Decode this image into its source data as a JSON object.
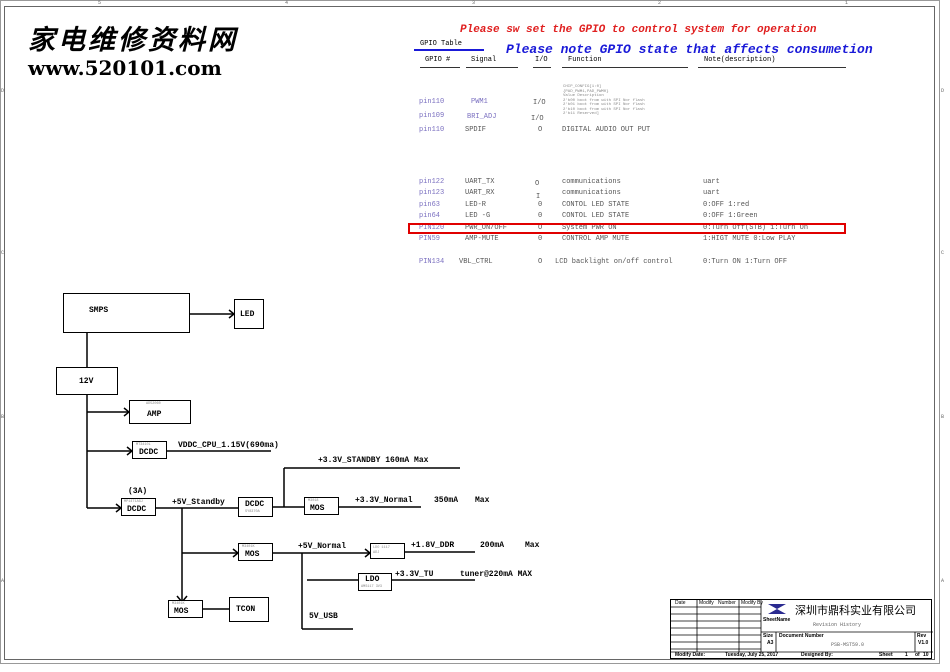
{
  "ruler": {
    "marks": [
      "5",
      "4",
      "3",
      "2",
      "1"
    ],
    "side_marks": [
      "D",
      "C",
      "B",
      "A"
    ]
  },
  "watermark": {
    "chinese": "家电维修资料网",
    "url": "www.520101.com"
  },
  "notes": {
    "red_title": "Please sw set the GPIO to control system for operation",
    "blue_title": "Please note GPIO state that affects consumetion"
  },
  "gpio_table": {
    "title": "GPIO Table",
    "headers": {
      "gpio": "GPIO #",
      "signal": "Signal",
      "io": "I/O",
      "function": "Function",
      "note": "Note(description)"
    },
    "chip_config": {
      "lines": [
        "CHIP_CONFIG[1:0]",
        "{PAD_PWM1,PAD_PWM0}",
        "Value        Description",
        "2'b00     boot from  with SPI Nor flash",
        "2'b01     boot from  with SPI Nor flash",
        "2'b10     boot from  with SPI Nor flash",
        "2'b11     Reserved]"
      ]
    },
    "rows": [
      {
        "pin": "pin110",
        "signal": "PWM1",
        "io": "I/O",
        "function": "",
        "note": ""
      },
      {
        "pin": "pin109",
        "signal": "BRI_ADJ",
        "io": "I/O",
        "function": "",
        "note": ""
      },
      {
        "pin": "pin110",
        "signal": "SPDIF",
        "io": "O",
        "function": "DIGITAL AUDIO OUT PUT",
        "note": ""
      },
      {
        "pin": "pin122",
        "signal": "UART_TX",
        "io": "O",
        "function": "communications",
        "note": "uart"
      },
      {
        "pin": "pin123",
        "signal": "UART_RX",
        "io": "I",
        "function": "communications",
        "note": "uart"
      },
      {
        "pin": "pin63",
        "signal": "LED-R",
        "io": "0",
        "function": "CONTOL LED STATE",
        "note": "0:OFF   1:red"
      },
      {
        "pin": "pin64",
        "signal": "LED -G",
        "io": "0",
        "function": "CONTOL LED STATE",
        "note": "0:OFF  1:Green"
      },
      {
        "pin": "PIN120",
        "signal": "PWR_ON/OFF",
        "io": "O",
        "function": "System PWR ON",
        "note": "0:Turn Off(STB)   1:Turn On"
      },
      {
        "pin": "PIN59",
        "signal": "AMP-MUTE",
        "io": "0",
        "function": "CONTROL AMP MUTE",
        "note": "1:HIGT MUTE  0:Low PLAY"
      },
      {
        "pin": "PIN134",
        "signal": "VBL_CTRL",
        "io": "O",
        "function": "LCD backlight on/off control",
        "note": "0:Turn ON  1:Turn OFF"
      }
    ],
    "highlighted_pin": "PIN120",
    "highlight_color": "#e00000"
  },
  "power_tree": {
    "smps": "SMPS",
    "led": "LED",
    "v12": "12V",
    "amp": {
      "label": "AMP",
      "part": "AD52060"
    },
    "dcdc_cpu": {
      "label": "DCDC",
      "part": "MT3410L",
      "rail": "VDDC_CPU_1.15V(690ma)"
    },
    "dcdc_5v": {
      "label": "DCDC",
      "part": "MP1471AGJ",
      "current": "(3A)",
      "rail": "+5V_Standby"
    },
    "dcdc_33": {
      "label": "DCDC",
      "part": "SY8370A"
    },
    "standby_rail": "+3.3V_STANDBY  160mA   Max",
    "mos_33": {
      "label": "MOS",
      "part": "M3018",
      "rail": "+3.3V_Normal",
      "current": "350mA",
      "max": "Max"
    },
    "mos_5v": {
      "label": "MOS",
      "part": "M3401K",
      "rail": "+5V_Normal"
    },
    "ldo_ddr": {
      "part_line1": "LDO 1117",
      "part_line2": "ADJ",
      "rail": "+1.8V_DDR",
      "current": "200mA",
      "max": "Max"
    },
    "ldo_tu": {
      "label": "LDO",
      "part": "AMS117 3V3",
      "rail": "+3.3V_TU",
      "current": "tuner@220mA MAX"
    },
    "usb_rail": "5V_USB",
    "mos_tcon": {
      "label": "MOS",
      "part": "M3401K"
    },
    "tcon": "TCON"
  },
  "title_block": {
    "rev_headers": [
      "Date",
      "Modify",
      "Number",
      "Modify By"
    ],
    "company": "深圳市鼎科实业有限公司",
    "sheet_name_label": "SheetName",
    "sheet_name": "Revision History",
    "size_label": "Size",
    "size": "A3",
    "doc_number_label": "Document Number",
    "doc_number": "PSB-MST59.0",
    "rev_label": "Rev",
    "rev": "V1.0",
    "modify_date_label": "Modify  Date:",
    "modify_date": "Tuesday, July 25, 2017",
    "designed_by_label": "Designed  By:",
    "sheet_label": "Sheet",
    "sheet": "1",
    "of_label": "of",
    "total": "10"
  }
}
